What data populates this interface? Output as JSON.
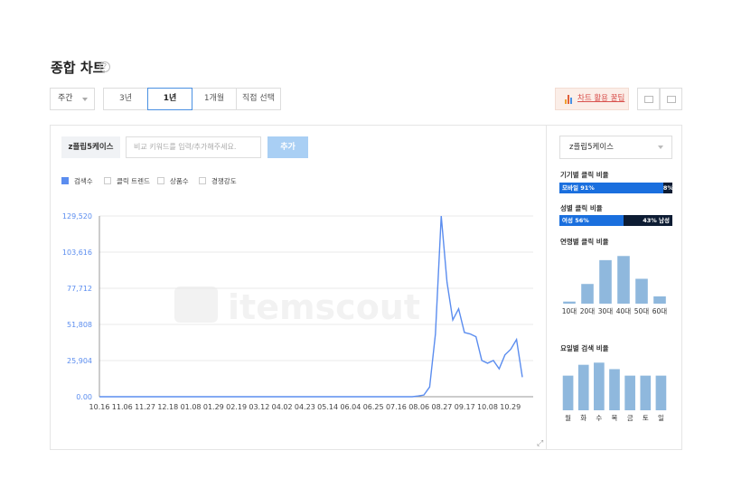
{
  "header": {
    "title": "종합 차트",
    "help": "?"
  },
  "period": {
    "selected": "주간"
  },
  "ranges": [
    {
      "label": "3년",
      "active": false
    },
    {
      "label": "1년",
      "active": true
    },
    {
      "label": "1개월",
      "active": false
    },
    {
      "label": "직접 선택",
      "active": false
    }
  ],
  "tip_button": {
    "label": "차트 활용 꿀팁"
  },
  "keyword": {
    "tag": "z플립5케이스",
    "placeholder": "비교 키워드를 입력/추가해주세요.",
    "add_label": "추가"
  },
  "legend": [
    {
      "label": "검색수",
      "checked": true
    },
    {
      "label": "클릭 트렌드",
      "checked": false
    },
    {
      "label": "상품수",
      "checked": false
    },
    {
      "label": "경쟁강도",
      "checked": false
    }
  ],
  "watermark": {
    "text": "itemscout"
  },
  "chart_data": {
    "type": "line",
    "y_ticks": [
      "129,520",
      "103,616",
      "77,712",
      "51,808",
      "25,904",
      "0.00"
    ],
    "ylim": [
      0,
      129520
    ],
    "x_ticks": [
      "10.16",
      "11.06",
      "11.27",
      "12.18",
      "01.08",
      "01.29",
      "02.19",
      "03.12",
      "04.02",
      "04.23",
      "05.14",
      "06.04",
      "06.25",
      "07.16",
      "08.06",
      "08.27",
      "09.17",
      "10.08",
      "10.29"
    ],
    "series": [
      {
        "values": [
          0,
          0,
          0,
          0,
          0,
          0,
          0,
          0,
          0,
          0,
          0,
          0,
          0,
          0,
          0,
          0,
          0,
          0,
          0,
          0,
          0,
          0,
          0,
          0,
          0,
          0,
          0,
          0,
          0,
          0,
          0,
          0,
          0,
          0,
          0,
          0,
          0,
          0,
          0,
          0,
          0,
          0,
          0,
          0,
          0,
          0,
          0,
          0,
          0,
          0,
          0,
          0,
          0,
          0,
          0,
          500,
          1200,
          7000,
          45000,
          129520,
          82000,
          55000,
          63000,
          46000,
          45000,
          43000,
          26000,
          24000,
          26000,
          20000,
          30000,
          34000,
          41000,
          14000
        ],
        "color": "#5b8def"
      }
    ]
  },
  "sidebar": {
    "select": "z플립5케이스",
    "device": {
      "title": "기기별 클릭 비율",
      "left_label": "모바일 91%",
      "right_label": "8% PC",
      "left_value": 91,
      "right_value": 8
    },
    "gender": {
      "title": "성별 클릭 비율",
      "left_label": "여성 56%",
      "right_label": "43% 남성",
      "left_value": 56,
      "right_value": 43
    },
    "age": {
      "title": "연령별 클릭 비율",
      "categories": [
        "10대",
        "20대",
        "30대",
        "40대",
        "50대",
        "60대"
      ],
      "values": [
        2,
        19,
        42,
        46,
        24,
        7
      ]
    },
    "weekday": {
      "title": "요일별 검색 비율",
      "categories": [
        "월",
        "화",
        "수",
        "목",
        "금",
        "토",
        "일"
      ],
      "values": [
        16,
        21,
        22,
        19,
        16,
        16,
        16
      ]
    }
  },
  "colors": {
    "accent": "#4a90e2",
    "line": "#5b8def",
    "bar": "#8fb8dd",
    "mobile": "#1a6fde",
    "dark": "#0d1c33",
    "tip": "#d9534f"
  }
}
